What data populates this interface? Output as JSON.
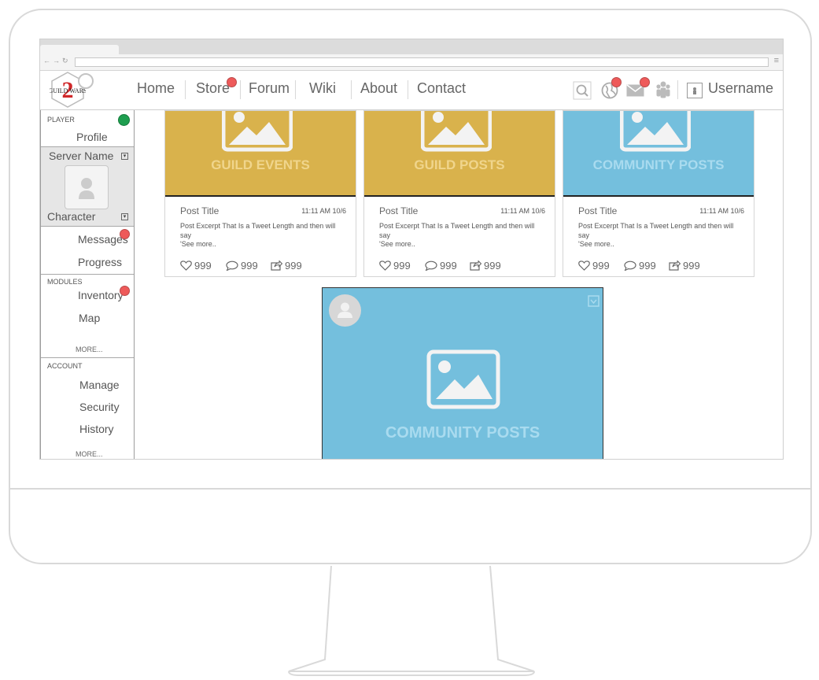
{
  "nav": {
    "items": [
      "Home",
      "Store",
      "Forum",
      "Wiki",
      "About",
      "Contact"
    ],
    "username": "Username",
    "icons": [
      "search-icon",
      "globe-icon",
      "mail-icon",
      "group-icon",
      "user-icon"
    ]
  },
  "logo": {
    "text": "GUILD WARS",
    "numeral": "2"
  },
  "sidebar": {
    "player_title": "PLAYER",
    "profile": "Profile",
    "server_name": "Server Name",
    "character": "Character",
    "messages": "Messages",
    "progress": "Progress",
    "modules_title": "MODULES",
    "inventory": "Inventory",
    "map": "Map",
    "modules_more": "MORE...",
    "account_title": "ACCOUNT",
    "manage": "Manage",
    "security": "Security",
    "history": "History",
    "account_more": "MORE..."
  },
  "cards": [
    {
      "label": "GUILD EVENTS",
      "color": "#d9b24c",
      "label_color": "#f0d58c",
      "title": "Post Title",
      "time": "11:11 AM 10/6",
      "excerpt": "Post Excerpt That Is a Tweet Length and then will say",
      "see_more": "'See more..",
      "likes": "999",
      "comments": "999",
      "shares": "999"
    },
    {
      "label": "GUILD POSTS",
      "color": "#d9b24c",
      "label_color": "#f0d58c",
      "title": "Post Title",
      "time": "11:11 AM 10/6",
      "excerpt": "Post Excerpt That Is a Tweet Length and then will say",
      "see_more": "'See more..",
      "likes": "999",
      "comments": "999",
      "shares": "999"
    },
    {
      "label": "COMMUNITY POSTS",
      "color": "#74bfdd",
      "label_color": "#a9dbef",
      "title": "Post Title",
      "time": "11:11 AM 10/6",
      "excerpt": "Post Excerpt That Is a Tweet Length and then will say",
      "see_more": "'See more..",
      "likes": "999",
      "comments": "999",
      "shares": "999"
    }
  ],
  "big_card": {
    "label": "COMMUNITY POSTS",
    "color": "#74bfdd"
  },
  "colors": {
    "notification": "#ee5a5a",
    "online": "#1e9e4f"
  }
}
